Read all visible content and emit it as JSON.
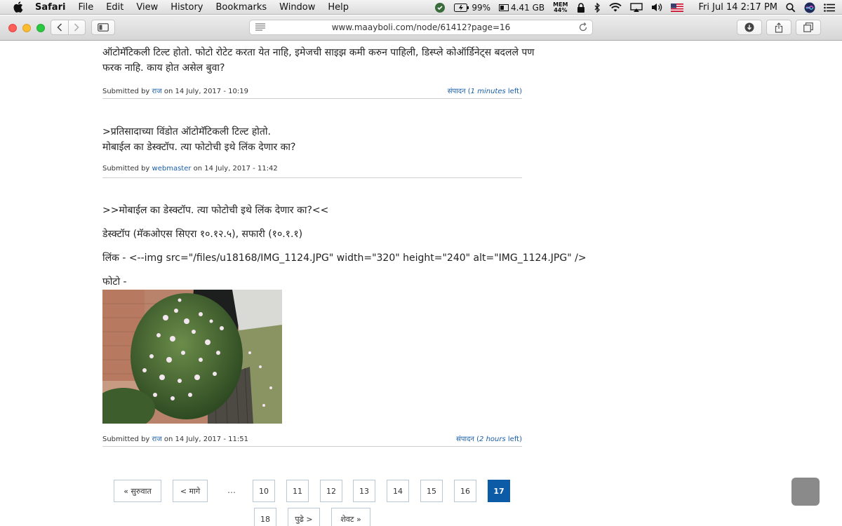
{
  "menubar": {
    "app": "Safari",
    "items": [
      "File",
      "Edit",
      "View",
      "History",
      "Bookmarks",
      "Window",
      "Help"
    ],
    "battery": "99%",
    "memory": "4.41 GB",
    "mem_label": "MEM",
    "mem_pct": "44%",
    "clock": "Fri Jul 14  2:17 PM"
  },
  "toolbar": {
    "url": "www.maayboli.com/node/61412?page=16"
  },
  "comments": [
    {
      "line1": "ऑटोमॅटिकली टिल्ट होतो. फोटो रोटेट करता येत नाहि, इमेजची साइझ कमी करुन पाहिली, डिस्प्ले कोऑर्डिनेट्स बदलले पण",
      "line2": "फरक नाहि. काय होत असेल बुवा?",
      "submitted_by": "Submitted by",
      "author": "राज",
      "date": "on 14 July, 2017 - 10:19",
      "edit": "संपादन",
      "edit_time": "1 minutes",
      "edit_left": "left"
    },
    {
      "line1": ">प्रतिसादाच्या विंडोत ऑटोमॅटिकली टिल्ट होतो.",
      "line2": "मोबाईल का डेस्क्टॉप. त्या फोटोची इथे लिंक देणार का?",
      "submitted_by": "Submitted by",
      "author": "webmaster",
      "date": "on 14 July, 2017 - 11:42"
    },
    {
      "quote": ">>मोबाईल का डेस्क्टॉप. त्या फोटोची इथे लिंक देणार का?<<",
      "desktop": "डेस्क्टॉप (मॅकओएस सिएरा १०.१२.५), सफारी (१०.१.१)",
      "link": "लिंक - <--img src=\"/files/u18168/IMG_1124.JPG\" width=\"320\" height=\"240\" alt=\"IMG_1124.JPG\" />",
      "photo_label": "फोटो -",
      "submitted_by": "Submitted by",
      "author": "राज",
      "date": "on 14 July, 2017 - 11:51",
      "edit": "संपादन",
      "edit_time": "2 hours",
      "edit_left": "left"
    }
  ],
  "pager": {
    "first": "« सुरुवात",
    "prev": "< मागे",
    "ellipsis": "…",
    "pages": [
      "10",
      "11",
      "12",
      "13",
      "14",
      "15",
      "16",
      "17",
      "18"
    ],
    "current": "17",
    "next": "पुढे >",
    "last": "शेवट »"
  },
  "colors": {
    "link": "#1a5ea8",
    "pager_active": "#0b5ba6"
  }
}
